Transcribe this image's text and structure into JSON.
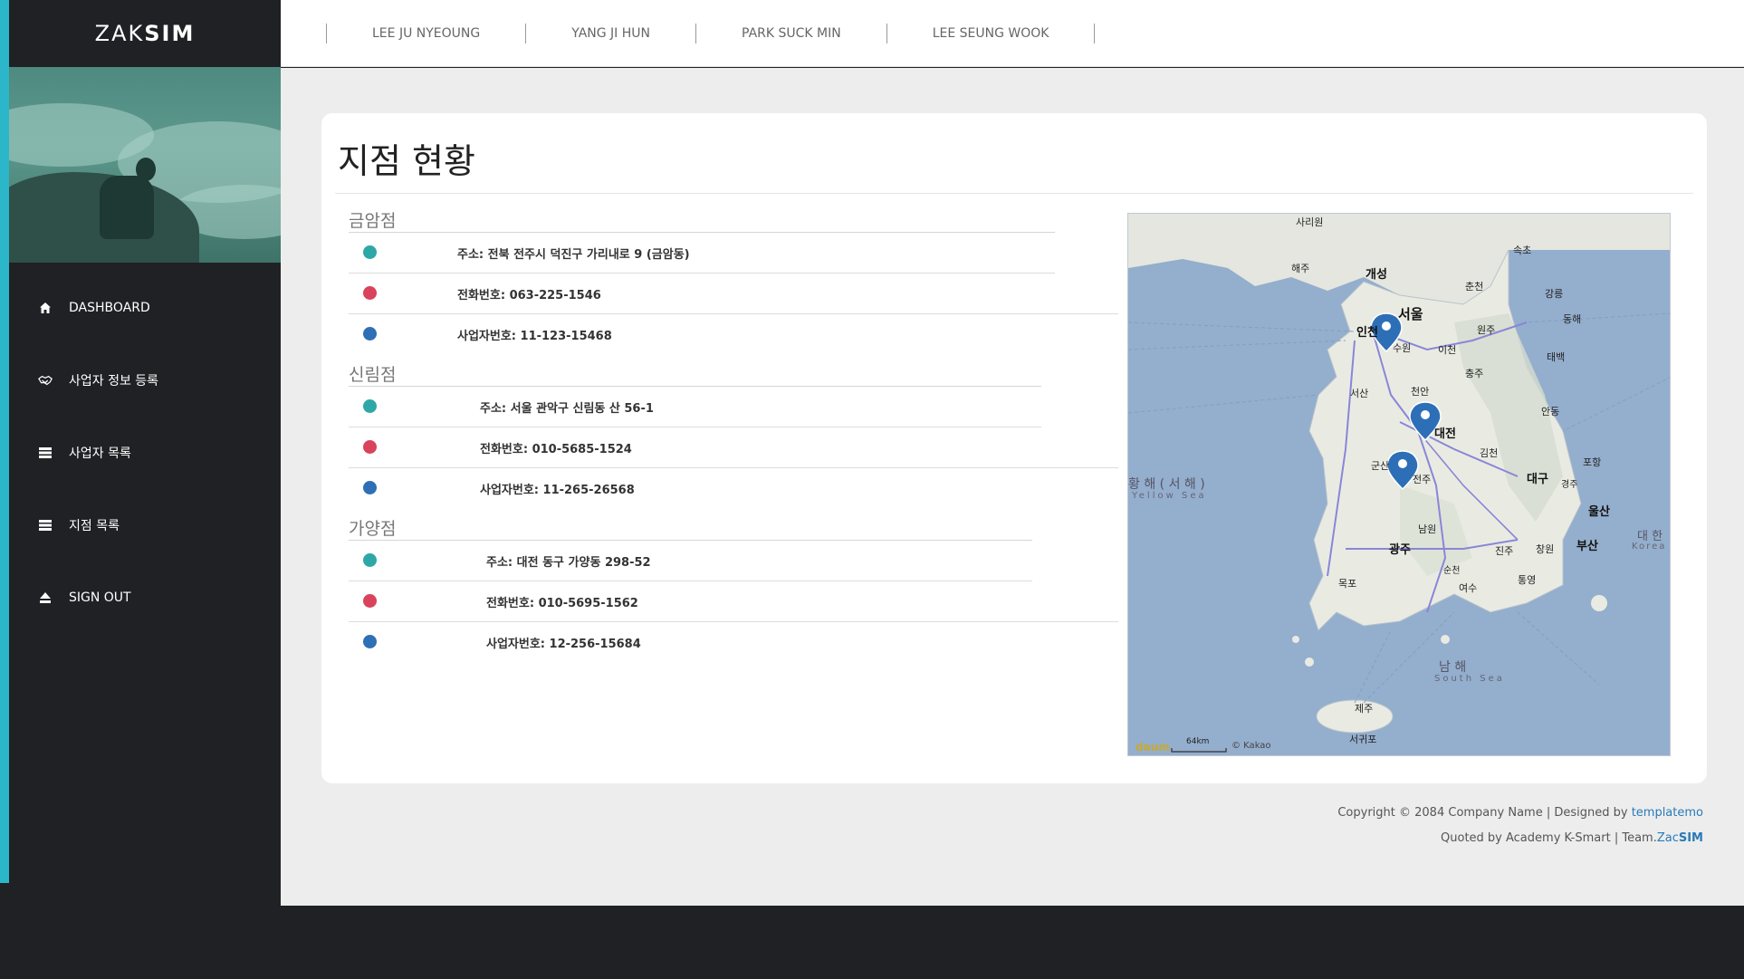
{
  "brand": {
    "light": "ZAK",
    "bold": "SIM"
  },
  "sidebar": {
    "items": [
      {
        "label": "DASHBOARD",
        "icon": "home-icon"
      },
      {
        "label": "사업자 정보 등록",
        "icon": "handshake-icon"
      },
      {
        "label": "사업자 목록",
        "icon": "list-icon"
      },
      {
        "label": "지점 목록",
        "icon": "list-icon"
      },
      {
        "label": "SIGN OUT",
        "icon": "eject-icon"
      }
    ]
  },
  "topnav": {
    "links": [
      "LEE JU NYEOUNG",
      "YANG JI HUN",
      "PARK SUCK MIN",
      "LEE SEUNG WOOK"
    ]
  },
  "page": {
    "title": "지점 현황"
  },
  "branches": [
    {
      "name": "금암점",
      "address": "주소: 전북 전주시 덕진구 가리내로 9 (금암동)",
      "phone": "전화번호: 063-225-1546",
      "bizno": "사업자번호: 11-123-15468"
    },
    {
      "name": "신림점",
      "address": "주소: 서울 관악구 신림동 산 56-1",
      "phone": "전화번호: 010-5685-1524",
      "bizno": "사업자번호: 11-265-26568"
    },
    {
      "name": "가양점",
      "address": "주소: 대전 동구 가양동 298-52",
      "phone": "전화번호: 010-5695-1562",
      "bizno": "사업자번호: 12-256-15684"
    }
  ],
  "colors": {
    "teal": "#2ea7a7",
    "red": "#d9435c",
    "blue": "#2f6fb5",
    "accent": "#2bb7c9",
    "dark": "#1f2124"
  },
  "map": {
    "labels": {
      "yellow_sea": "황 해 ( 서 해 )",
      "yellow_sea_en": "Yellow Sea",
      "south_sea": "남 해",
      "south_sea_en": "South Sea",
      "east_sea": "대 한",
      "east_sea_en": "Korea",
      "seoul": "서울",
      "incheon": "인천",
      "daejeon": "대전",
      "jeonju": "전주",
      "daegu": "대구",
      "gwangju": "광주",
      "busan": "부산",
      "ulsan": "울산",
      "gaeseong": "개성",
      "haeju": "해주",
      "sariwon": "사리원",
      "sokcho": "속초",
      "gangneung": "강릉",
      "donghae": "동해",
      "wonju": "원주",
      "chungju": "충주",
      "andong": "안동",
      "pohang": "포항",
      "gyeongju": "경주",
      "jinju": "진주",
      "changwon": "창원",
      "mokpo": "목포",
      "yeosu": "여수",
      "suncheon": "순천",
      "tongyeong": "통영",
      "jeju": "제주",
      "seogwipo": "서귀포",
      "gimcheon": "김천",
      "gunsan": "군산",
      "cheonan": "천안",
      "seosan": "서산",
      "suwon": "수원",
      "icheon": "이천",
      "chuncheon": "춘천",
      "taebaek": "태백",
      "namwon": "남원",
      "scale": "64km",
      "copyright": "© Kakao",
      "logo": "daum"
    }
  },
  "footer": {
    "line1_prefix": "Copyright © 2084 Company Name | Designed by ",
    "line1_link": "templatemo",
    "line2_prefix": "Quoted by Academy K-Smart | Team.",
    "line2_link_light": "Zac",
    "line2_link_bold": "SIM"
  }
}
